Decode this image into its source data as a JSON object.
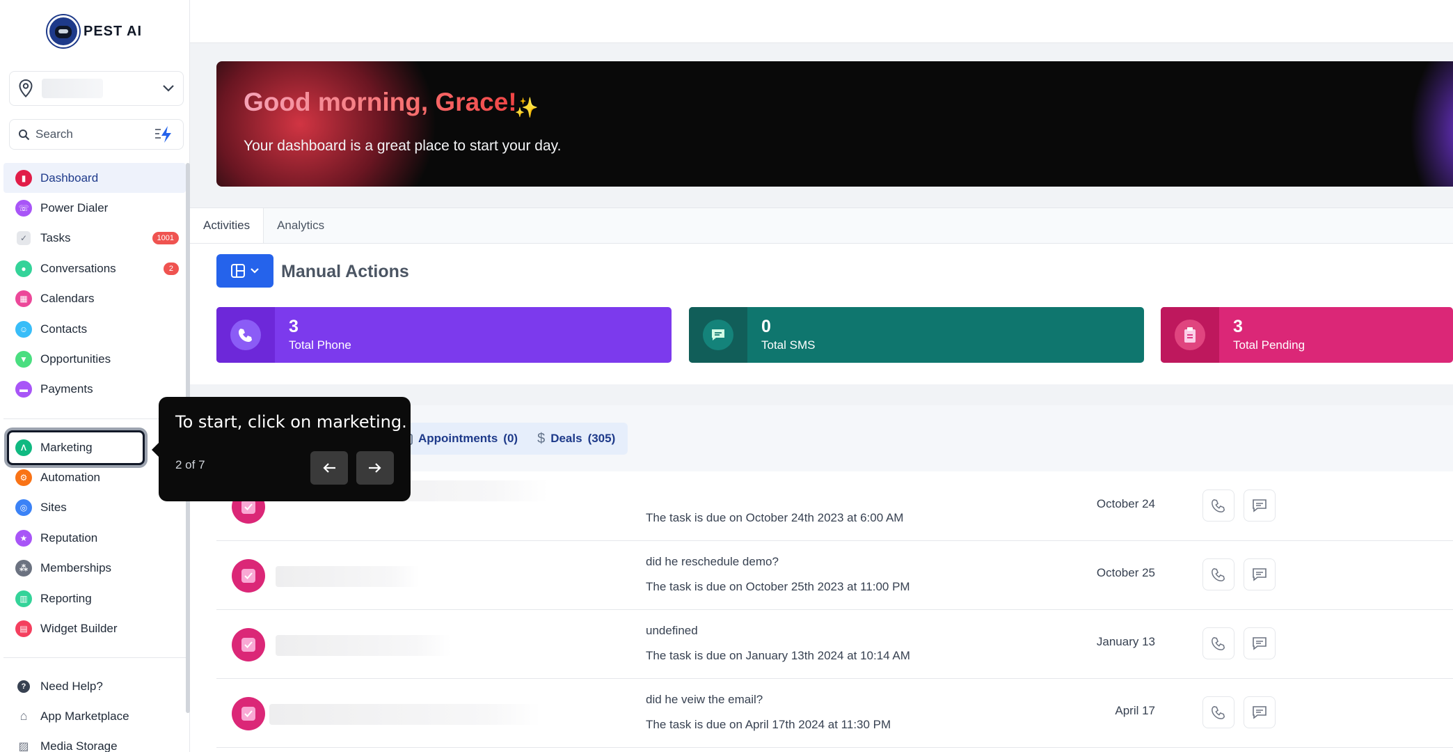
{
  "brand": {
    "name": "PEST AI"
  },
  "search": {
    "placeholder": "Search"
  },
  "sidebar": {
    "items": [
      {
        "label": "Dashboard",
        "color": "#e11d48",
        "active": true
      },
      {
        "label": "Power Dialer",
        "color": "#a855f7"
      },
      {
        "label": "Tasks",
        "color": "#d1d5db",
        "badge": "1001"
      },
      {
        "label": "Conversations",
        "color": "#34d399",
        "badge": "2"
      },
      {
        "label": "Calendars",
        "color": "#ec4899"
      },
      {
        "label": "Contacts",
        "color": "#38bdf8"
      },
      {
        "label": "Opportunities",
        "color": "#4ade80"
      },
      {
        "label": "Payments",
        "color": "#a855f7"
      }
    ],
    "items2": [
      {
        "label": "Marketing",
        "color": "#10b981"
      },
      {
        "label": "Automation",
        "color": "#f97316"
      },
      {
        "label": "Sites",
        "color": "#3b82f6"
      },
      {
        "label": "Reputation",
        "color": "#a855f7"
      },
      {
        "label": "Memberships",
        "color": "#6b7280"
      },
      {
        "label": "Reporting",
        "color": "#34d399"
      },
      {
        "label": "Widget Builder",
        "color": "#f43f5e"
      }
    ],
    "items3": [
      {
        "label": "Need Help?"
      },
      {
        "label": "App Marketplace"
      },
      {
        "label": "Media Storage"
      }
    ]
  },
  "hero": {
    "title": "Good morning, Grace!",
    "subtitle": "Your dashboard is a great place to start your day."
  },
  "tabs": [
    {
      "label": "Activities",
      "active": true
    },
    {
      "label": "Analytics"
    }
  ],
  "manual_actions": {
    "title": "Manual Actions",
    "stats": [
      {
        "value": "3",
        "label": "Total Phone",
        "color": "#7c3aed",
        "icon_bg": "#6d28d9"
      },
      {
        "value": "0",
        "label": "Total SMS",
        "color": "#0f766e",
        "icon_bg": "#115e59"
      },
      {
        "value": "3",
        "label": "Total Pending",
        "color": "#db2777",
        "icon_bg": "#be185d"
      }
    ]
  },
  "filters": [
    {
      "label": "Appointments",
      "count": "(0)",
      "icon": "calendar-icon"
    },
    {
      "label": "Deals",
      "count": "(305)",
      "icon": "dollar-icon"
    }
  ],
  "tasks": [
    {
      "desc": "",
      "due": "The task is due on October 24th 2023 at 6:00 AM",
      "date": "October 24"
    },
    {
      "desc": "did he reschedule demo?",
      "due": "The task is due on October 25th 2023 at 11:00 PM",
      "date": "October 25"
    },
    {
      "desc": "undefined",
      "due": "The task is due on January 13th 2024 at 10:14 AM",
      "date": "January 13"
    },
    {
      "desc": "did he veiw the email?",
      "due": "The task is due on April 17th 2024 at 11:30 PM",
      "date": "April 17"
    }
  ],
  "tooltip": {
    "message": "To start, click on marketing.",
    "step": "2 of 7"
  }
}
